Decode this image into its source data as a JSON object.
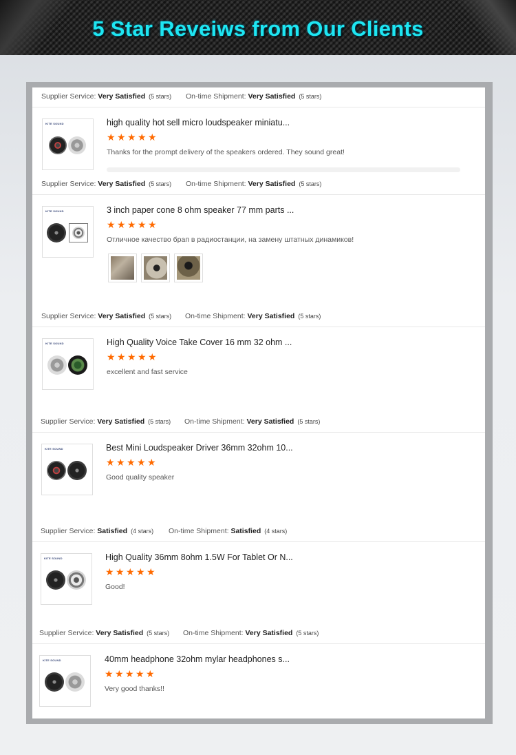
{
  "header": {
    "title": "5  Star Reveiws from Our Clients"
  },
  "thumb_brand": "KITE SOUND",
  "labels": {
    "supplier_service": "Supplier Service:",
    "on_time_shipment": "On-time Shipment:"
  },
  "colors": {
    "accent_title": "#1ee6f2",
    "star": "#ff6a00"
  },
  "reviews": [
    {
      "supplier_rating": "Very Satisfied",
      "supplier_stars": "(5 stars)",
      "shipment_rating": "Very Satisfied",
      "shipment_stars": "(5 stars)",
      "product_title": "high quality hot sell micro loudspeaker miniatu...",
      "rating": 5,
      "comment": "Thanks for the prompt delivery of the speakers ordered. They sound great!"
    },
    {
      "supplier_rating": "Very Satisfied",
      "supplier_stars": "(5 stars)",
      "shipment_rating": "Very Satisfied",
      "shipment_stars": "(5 stars)",
      "product_title": "3 inch paper cone 8 ohm speaker 77 mm parts ...",
      "rating": 5,
      "comment": "Отличное качество брап в радиостанции, на замену штатных динамиков!"
    },
    {
      "supplier_rating": "Very Satisfied",
      "supplier_stars": "(5 stars)",
      "shipment_rating": "Very Satisfied",
      "shipment_stars": "(5 stars)",
      "product_title": "High Quality Voice Take Cover 16 mm 32 ohm ...",
      "rating": 5,
      "comment": "excellent and fast service"
    },
    {
      "supplier_rating": "Very Satisfied",
      "supplier_stars": "(5 stars)",
      "shipment_rating": "Very Satisfied",
      "shipment_stars": "(5 stars)",
      "product_title": "Best Mini Loudspeaker Driver 36mm 32ohm 10...",
      "rating": 5,
      "comment": "Good quality speaker"
    },
    {
      "supplier_rating": "Satisfied",
      "supplier_stars": "(4 stars)",
      "shipment_rating": "Satisfied",
      "shipment_stars": "(4 stars)",
      "product_title": "High Quality 36mm 8ohm 1.5W For Tablet Or N...",
      "rating": 5,
      "comment": "Good!"
    },
    {
      "supplier_rating": "Very Satisfied",
      "supplier_stars": "(5 stars)",
      "shipment_rating": "Very Satisfied",
      "shipment_stars": "(5 stars)",
      "product_title": "40mm headphone 32ohm mylar headphones s...",
      "rating": 5,
      "comment": "Very good thanks!!"
    }
  ]
}
